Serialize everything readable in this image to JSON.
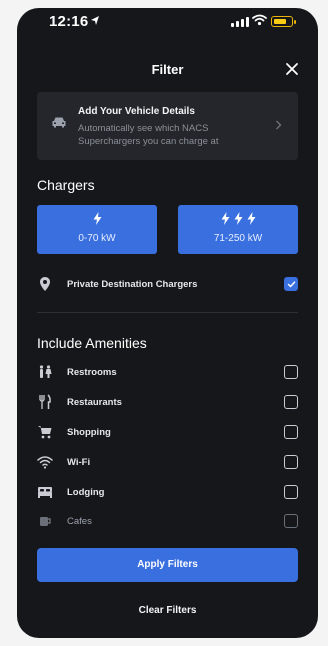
{
  "status_bar": {
    "time": "12:16"
  },
  "header": {
    "title": "Filter"
  },
  "vehicle_card": {
    "title": "Add Your Vehicle Details",
    "description": "Automatically see which NACS Superchargers you can charge at"
  },
  "chargers": {
    "title": "Chargers",
    "speeds": [
      {
        "label": "0-70 kW",
        "bolts": 1
      },
      {
        "label": "71-250 kW",
        "bolts": 3
      }
    ],
    "private": {
      "label": "Private Destination Chargers",
      "checked": true
    }
  },
  "amenities": {
    "title": "Include Amenities",
    "items": [
      {
        "label": "Restrooms",
        "icon": "restroom-icon",
        "checked": false
      },
      {
        "label": "Restaurants",
        "icon": "fork-knife-icon",
        "checked": false
      },
      {
        "label": "Shopping",
        "icon": "shopping-cart-icon",
        "checked": false
      },
      {
        "label": "Wi-Fi",
        "icon": "wifi-icon",
        "checked": false
      },
      {
        "label": "Lodging",
        "icon": "bed-icon",
        "checked": false
      },
      {
        "label": "Cafes",
        "icon": "coffee-cup-icon",
        "checked": false
      }
    ]
  },
  "actions": {
    "apply": "Apply Filters",
    "clear": "Clear Filters"
  },
  "colors": {
    "accent": "#3a6fdf",
    "background": "#16171b",
    "card": "#24262b",
    "battery": "#facc15"
  }
}
